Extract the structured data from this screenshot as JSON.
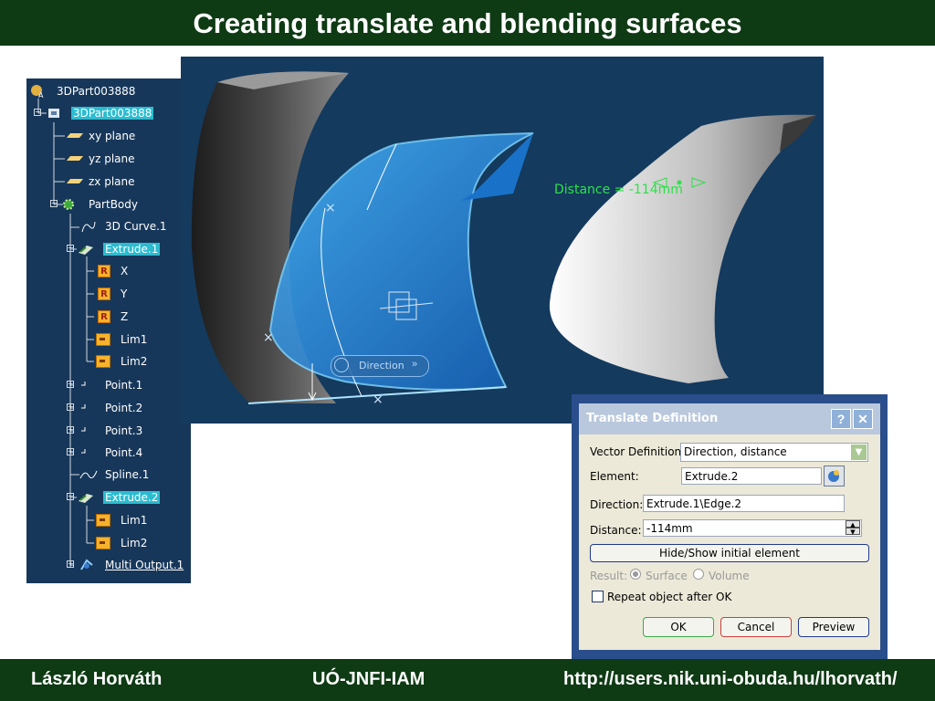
{
  "slide": {
    "title": "Creating  translate and blending surfaces",
    "footer_author": "László Horváth",
    "footer_org": "UÓ-JNFI-IAM",
    "footer_url": "http://users.nik.uni-obuda.hu/lhorvath/"
  },
  "tree": {
    "root": "3DPart003888",
    "part": "3DPart003888",
    "planes": [
      "xy plane",
      "yz plane",
      "zx plane"
    ],
    "body": "PartBody",
    "curve": "3D Curve.1",
    "extrude1": "Extrude.1",
    "extrude1_children": [
      "X",
      "Y",
      "Z",
      "Lim1",
      "Lim2"
    ],
    "points": [
      "Point.1",
      "Point.2",
      "Point.3",
      "Point.4"
    ],
    "spline": "Spline.1",
    "extrude2": "Extrude.2",
    "extrude2_children": [
      "Lim1",
      "Lim2"
    ],
    "multi": "Multi Output.1"
  },
  "viewport": {
    "distance_label": "Distance",
    "distance_value": "= -114mm",
    "direction_label": "Direction"
  },
  "dialog": {
    "title": "Translate Definition",
    "help": "?",
    "close": "✕",
    "vector_label": "Vector Definition:",
    "vector_value": "Direction, distance",
    "element_label": "Element:",
    "element_value": "Extrude.2",
    "direction_label": "Direction:",
    "direction_value": "Extrude.1\\Edge.2",
    "distance_label": "Distance:",
    "distance_value": "-114mm",
    "hide_show": "Hide/Show initial element",
    "result_label": "Result:",
    "result_surface": "Surface",
    "result_volume": "Volume",
    "repeat": "Repeat object after OK",
    "ok": "OK",
    "cancel": "Cancel",
    "preview": "Preview"
  },
  "colors": {
    "title_bar": "#0e3a14",
    "tree_bg": "#17375a",
    "viewport_bg": "#143a5e",
    "selection": "#2bbcd0",
    "preview_surface": "#29a9ff",
    "measure_green": "#2fe04a"
  }
}
